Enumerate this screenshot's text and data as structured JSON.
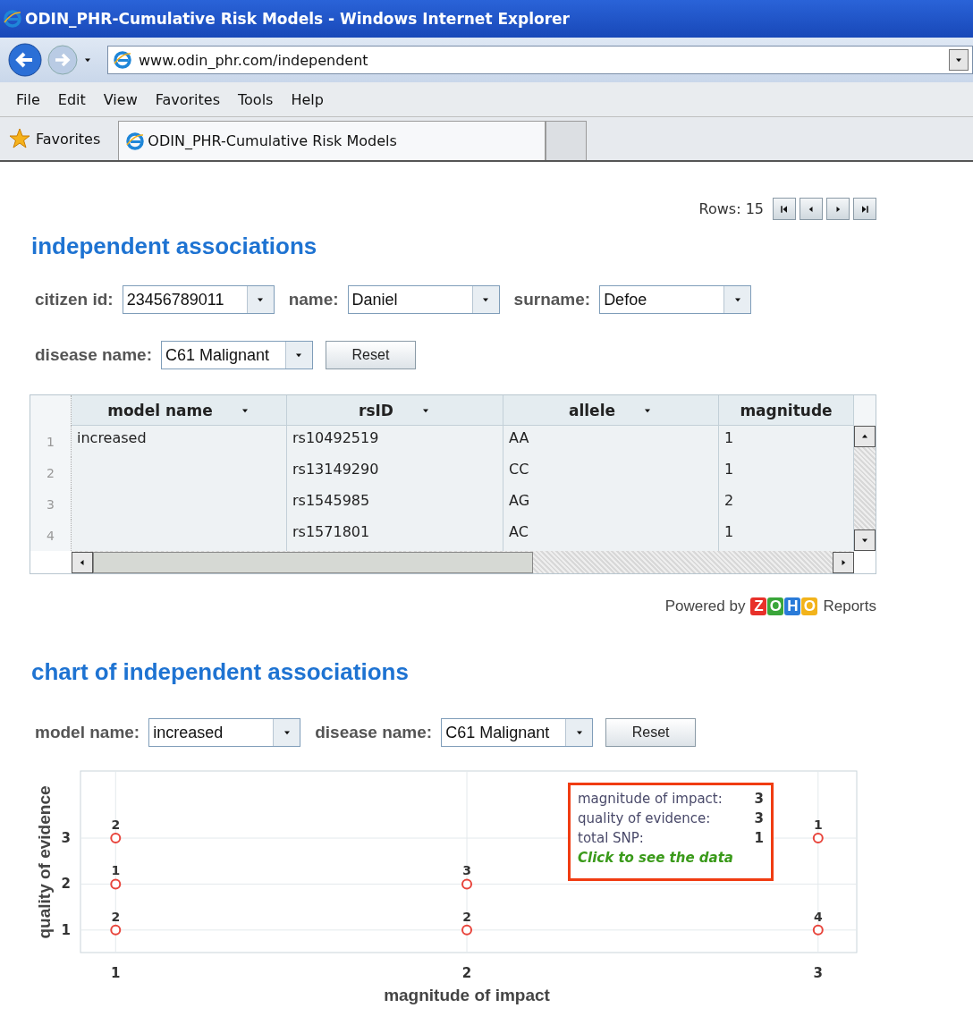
{
  "window": {
    "title": "ODIN_PHR-Cumulative Risk Models - Windows Internet Explorer"
  },
  "address_bar": {
    "url": "www.odin_phr.com/independent"
  },
  "menu": [
    "File",
    "Edit",
    "View",
    "Favorites",
    "Tools",
    "Help"
  ],
  "favorites_bar": {
    "label": "Favorites",
    "tabs": [
      {
        "title": "ODIN_PHR-Cumulative Risk Models",
        "selected": true
      }
    ]
  },
  "pager": {
    "label": "Rows: 15"
  },
  "table_section": {
    "title": "independent associations",
    "filters": [
      {
        "label": "citizen id:",
        "value": "23456789011"
      },
      {
        "label": "name:",
        "value": "Daniel"
      },
      {
        "label": "surname:",
        "value": "Defoe"
      },
      {
        "label": "disease name:",
        "value": "C61 Malignant"
      }
    ],
    "reset": "Reset",
    "table": {
      "columns": [
        "model name",
        "rsID",
        "allele",
        "magnitude"
      ],
      "rows": [
        {
          "num": "1",
          "cells": [
            "increased",
            "rs10492519",
            "AA",
            "1"
          ]
        },
        {
          "num": "2",
          "cells": [
            "",
            "rs13149290",
            "CC",
            "1"
          ]
        },
        {
          "num": "3",
          "cells": [
            "",
            "rs1545985",
            "AG",
            "2"
          ]
        },
        {
          "num": "4",
          "cells": [
            "",
            "rs1571801",
            "AC",
            "1"
          ]
        }
      ]
    },
    "powered_by": "Powered by",
    "brand": [
      "Z",
      "O",
      "H",
      "O"
    ],
    "reports": "Reports"
  },
  "chart_section": {
    "title": "chart of independent associations",
    "filters": [
      {
        "label": "model name:",
        "value": "increased"
      },
      {
        "label": "disease name:",
        "value": "C61 Malignant"
      }
    ],
    "reset": "Reset",
    "chart_data": {
      "type": "scatter",
      "xlabel": "magnitude of impact",
      "ylabel": "quality of evidence",
      "x": [
        1,
        1,
        1,
        2,
        2,
        3,
        3
      ],
      "series": [
        {
          "color": "#e8453c",
          "values": [
            3,
            2,
            1,
            2,
            1,
            3,
            1
          ]
        }
      ],
      "value_labels": [
        "2",
        "1",
        "2",
        "3",
        "2",
        "1",
        "4"
      ],
      "xlim": [
        0.9,
        3.11
      ],
      "ylim": [
        0.51,
        4.46
      ],
      "xticks": [
        1,
        2,
        3
      ],
      "yticks": [
        1,
        2,
        3
      ],
      "grid": true
    },
    "tooltip": {
      "rows": [
        {
          "label": "magnitude of impact:",
          "value": "3"
        },
        {
          "label": "quality of evidence:",
          "value": "3"
        },
        {
          "label": "total SNP:",
          "value": "1"
        }
      ],
      "link": "Click to see the data"
    }
  }
}
